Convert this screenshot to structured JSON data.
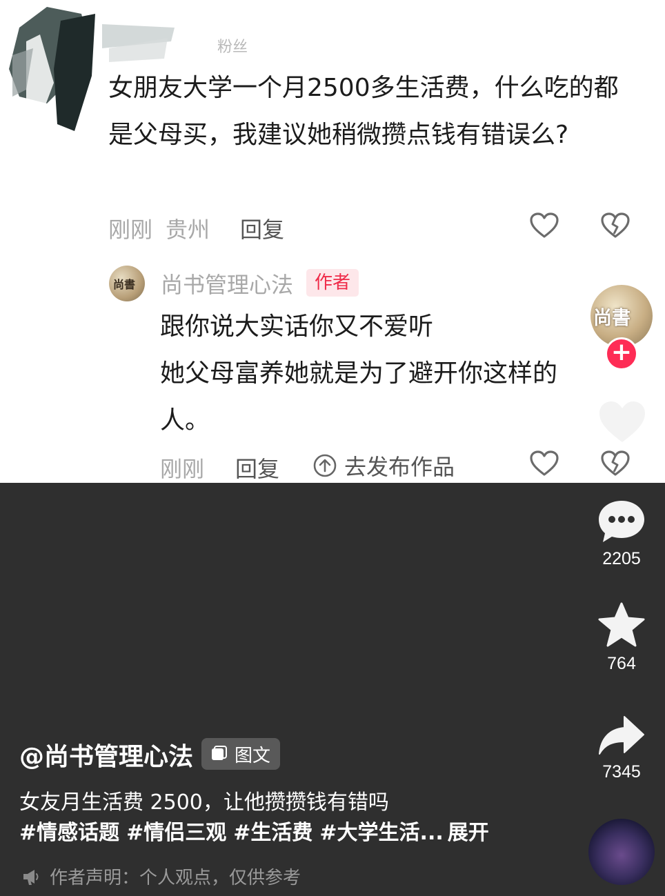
{
  "comment1": {
    "fan_tag": "粉丝",
    "text": "女朋友大学一个月2500多生活费，什么吃的都是父母买，我建议她稍微攒点钱有错误么?",
    "time": "刚刚",
    "location": "贵州",
    "reply": "回复",
    "like_icon": "heart-outline-icon",
    "dislike_icon": "broken-heart-icon"
  },
  "comment2": {
    "author_name": "尚书管理心法",
    "author_badge": "作者",
    "avatar_text": "尚書",
    "line1": "跟你说大实话你又不爱听",
    "line2": "她父母富养她就是为了避开你这样的人。",
    "time": "刚刚",
    "reply": "回复",
    "publish": "去发布作品"
  },
  "rail": {
    "avatar_text": "尚書",
    "follow_symbol": "+",
    "comments": "2205",
    "favorites": "764",
    "shares": "7345"
  },
  "post": {
    "author_handle": "@尚书管理心法",
    "type_badge": "图文",
    "caption": "女友月生活费 2500，让他攒攒钱有错吗",
    "hashtags": [
      "#情感话题",
      "#情侣三观",
      "#生活费",
      "#大学生活..."
    ],
    "expand": "展开",
    "disclaimer": "作者声明：个人观点，仅供参考"
  },
  "colors": {
    "accent": "#fe2c55",
    "badge_text": "#ef2b49",
    "dark_bg": "#2f2f2f"
  }
}
